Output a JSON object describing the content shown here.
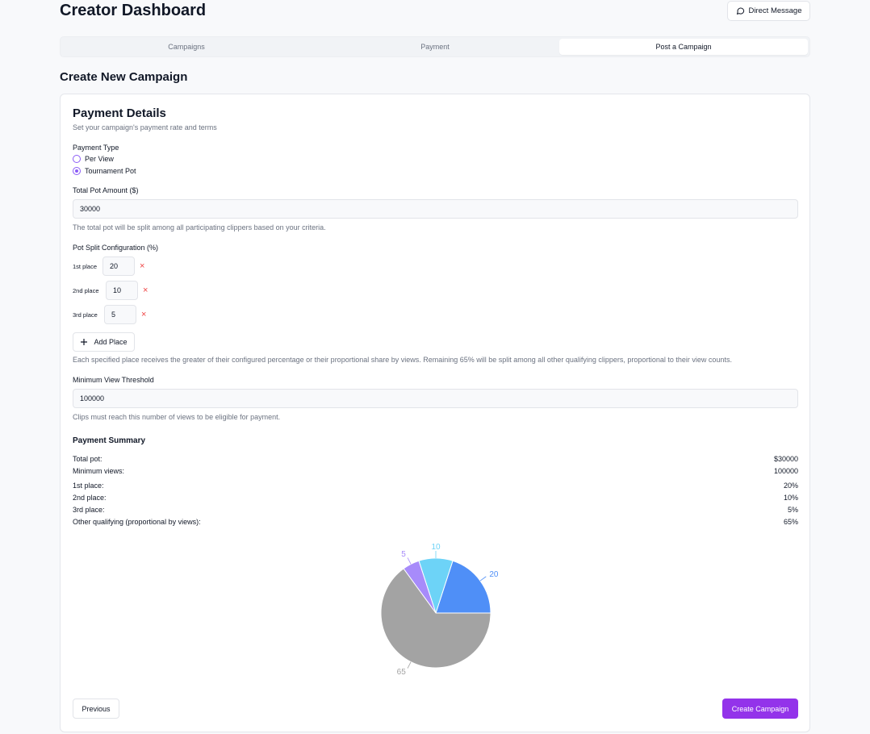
{
  "header": {
    "title": "Creator Dashboard",
    "dm_button": "Direct Message"
  },
  "tabs": [
    {
      "label": "Campaigns",
      "active": false
    },
    {
      "label": "Payment",
      "active": false
    },
    {
      "label": "Post a Campaign",
      "active": true
    }
  ],
  "section_title": "Create New Campaign",
  "card": {
    "title": "Payment Details",
    "subtitle": "Set your campaign's payment rate and terms",
    "payment_type": {
      "label": "Payment Type",
      "options": [
        {
          "label": "Per View",
          "checked": false
        },
        {
          "label": "Tournament Pot",
          "checked": true
        }
      ]
    },
    "total_pot": {
      "label": "Total Pot Amount ($)",
      "value": "30000",
      "hint": "The total pot will be split among all participating clippers based on your criteria."
    },
    "pot_split": {
      "label": "Pot Split Configuration (%)",
      "places": [
        {
          "label": "1st place",
          "value": "20",
          "remove": "×"
        },
        {
          "label": "2nd place",
          "value": "10",
          "remove": "×"
        },
        {
          "label": "3rd place",
          "value": "5",
          "remove": "×"
        }
      ],
      "add_button": "Add Place",
      "hint": "Each specified place receives the greater of their configured percentage or their proportional share by views. Remaining 65% will be split among all other qualifying clippers, proportional to their view counts."
    },
    "min_views": {
      "label": "Minimum View Threshold",
      "value": "100000",
      "hint": "Clips must reach this number of views to be eligible for payment."
    },
    "summary": {
      "title": "Payment Summary",
      "rows": [
        {
          "label": "Total pot:",
          "value": "$30000"
        },
        {
          "label": "Minimum views:",
          "value": "100000"
        },
        {
          "label": "1st place:",
          "value": "20%"
        },
        {
          "label": "2nd place:",
          "value": "10%"
        },
        {
          "label": "3rd place:",
          "value": "5%"
        },
        {
          "label": "Other qualifying (proportional by views):",
          "value": "65%"
        }
      ]
    },
    "buttons": {
      "previous": "Previous",
      "create": "Create Campaign"
    }
  },
  "chart_data": {
    "type": "pie",
    "categories": [
      "1st place",
      "2nd place",
      "3rd place",
      "Other qualifying"
    ],
    "values": [
      20,
      10,
      5,
      65
    ],
    "labels": [
      "20",
      "10",
      "5",
      "65"
    ],
    "colors": [
      "#4f8ff7",
      "#6dd3f7",
      "#a78bfa",
      "#a3a3a3"
    ]
  }
}
